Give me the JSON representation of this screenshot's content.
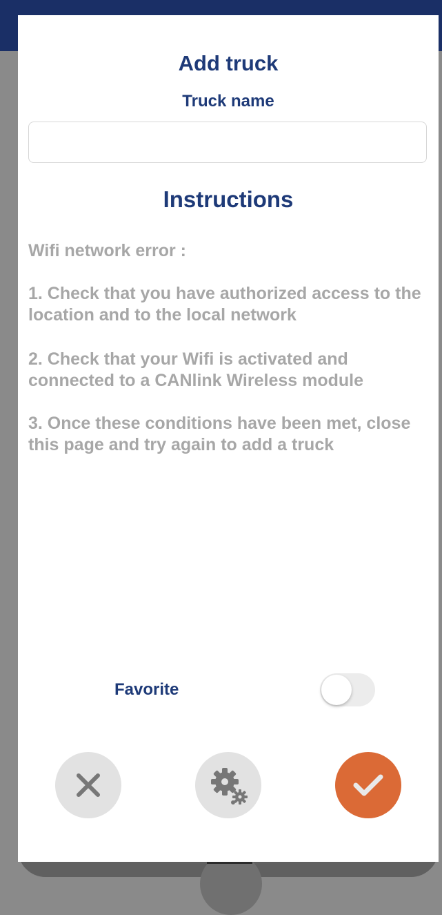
{
  "modal": {
    "title": "Add truck",
    "truck_name_label": "Truck name",
    "truck_name_value": "",
    "truck_name_placeholder": ""
  },
  "instructions": {
    "heading": "Instructions",
    "error_title": "Wifi network error :",
    "steps": [
      "1. Check that you have authorized access to the location and to the local network",
      "2. Check that your Wifi is activated and connected to a CANlink Wireless module",
      "3. Once these conditions have been met, close this page and try again to add a truck"
    ]
  },
  "favorite": {
    "label": "Favorite",
    "on": false
  },
  "actions": {
    "cancel_icon": "close-icon",
    "settings_icon": "gears-icon",
    "confirm_icon": "checkmark-icon"
  },
  "colors": {
    "header": "#1a2f66",
    "title_text": "#1e3a78",
    "instruction_text": "#a7a7a7",
    "confirm_button": "#db6a36",
    "neutral_button": "#e2e2e2"
  }
}
